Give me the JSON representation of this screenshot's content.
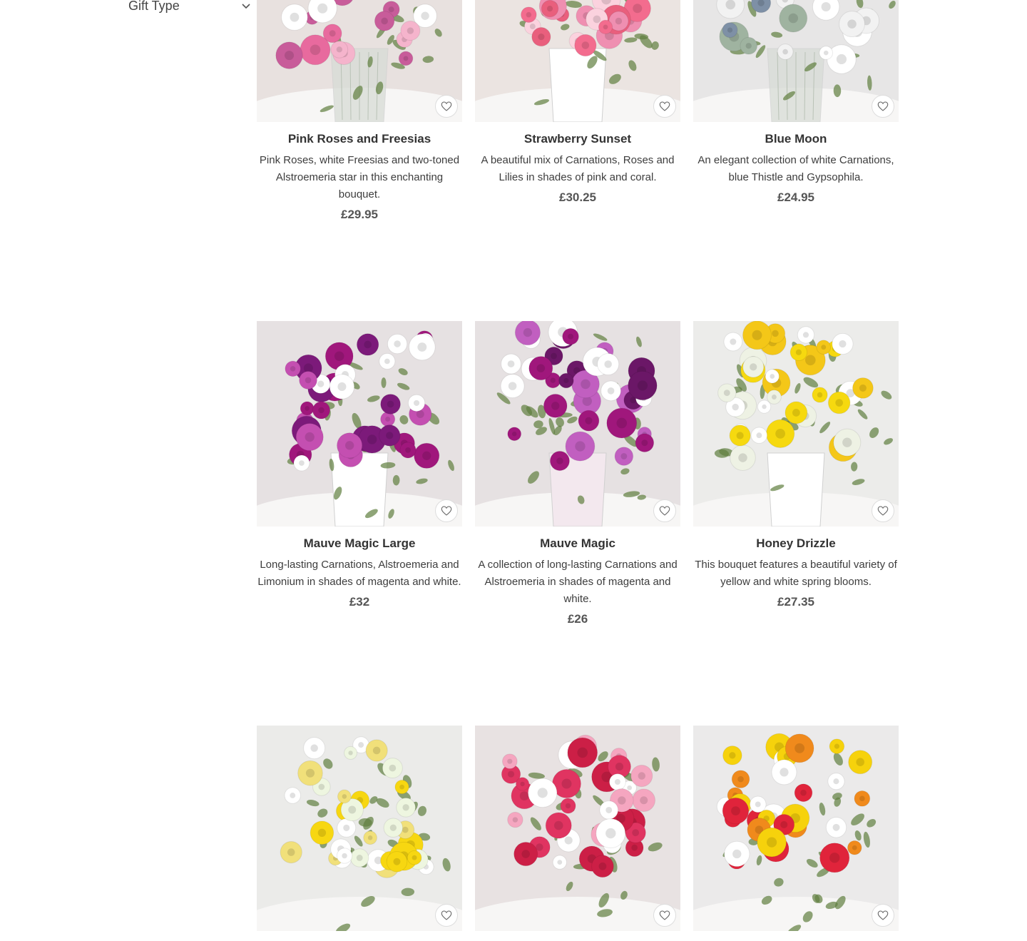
{
  "sidebar": {
    "filter_label": "Gift Type"
  },
  "products": [
    {
      "name": "Pink Roses and Freesias",
      "description": "Pink Roses, white Freesias and two-toned Alstroemeria star in this enchanting bouquet.",
      "price": "£29.95",
      "colors": [
        "#e86a9e",
        "#f5b4cc",
        "#ffffff",
        "#c85c9a"
      ],
      "bg": "#e8e1df",
      "vase": "glass"
    },
    {
      "name": "Strawberry Sunset",
      "description": "A beautiful mix of Carnations, Roses and Lilies in shades of pink and coral.",
      "price": "£30.25",
      "colors": [
        "#ef8fb1",
        "#f36c8e",
        "#fbd2de",
        "#e95f7d"
      ],
      "bg": "#ebe4e1",
      "vase": "jug"
    },
    {
      "name": "Blue Moon",
      "description": "An elegant collection of white Carnations, blue Thistle and Gypsophila.",
      "price": "£24.95",
      "colors": [
        "#ffffff",
        "#f2f2f2",
        "#7e90a6",
        "#9fb3a0"
      ],
      "bg": "#e7e6e6",
      "vase": "glass"
    },
    {
      "name": "Mauve Magic Large",
      "description": "Long-lasting Carnations, Alstroemeria and Limonium in shades of magenta and white.",
      "price": "£32",
      "colors": [
        "#a0177c",
        "#ffffff",
        "#c44fb1",
        "#7c1a7a"
      ],
      "bg": "#e6e1e2",
      "vase": "white"
    },
    {
      "name": "Mauve Magic",
      "description": "A collection of long-lasting Carnations and Alstroemeria in shades of magenta and white.",
      "price": "£26",
      "colors": [
        "#a0177c",
        "#ffffff",
        "#c15fc0",
        "#6b1767"
      ],
      "bg": "#e6e1e2",
      "vase": "pink"
    },
    {
      "name": "Honey Drizzle",
      "description": "This bouquet features a beautiful variety of yellow and white spring blooms.",
      "price": "£27.35",
      "colors": [
        "#f6d90f",
        "#ffffff",
        "#f4c718",
        "#eef2e4"
      ],
      "bg": "#ececea",
      "vase": "jug"
    },
    {
      "name": "",
      "description": "",
      "price": "",
      "colors": [
        "#f7d711",
        "#ffffff",
        "#f1e07a",
        "#eef6e0"
      ],
      "bg": "#ebebe9",
      "vase": "none"
    },
    {
      "name": "",
      "description": "",
      "price": "",
      "colors": [
        "#e03461",
        "#ffffff",
        "#f5a6c0",
        "#cc1f46"
      ],
      "bg": "#e8e2e2",
      "vase": "none"
    },
    {
      "name": "",
      "description": "",
      "price": "",
      "colors": [
        "#f6d20c",
        "#e0243b",
        "#ffffff",
        "#f08a1c"
      ],
      "bg": "#ebeaea",
      "vase": "none"
    }
  ],
  "icons": {
    "chevron": "chevron-down-icon",
    "favorite": "heart-outline-icon"
  },
  "colors": {
    "text": "#333333",
    "price": "#555555",
    "border": "#dddddd"
  }
}
